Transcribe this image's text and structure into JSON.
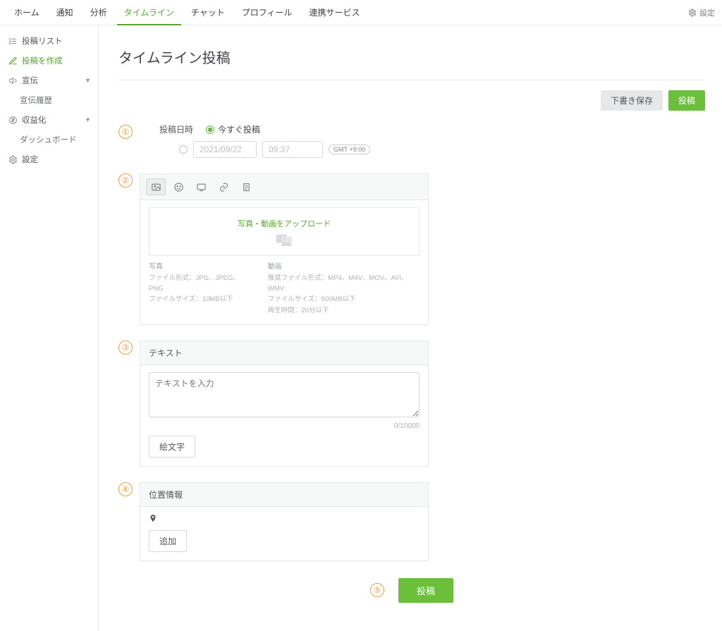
{
  "topnav": {
    "tabs": [
      "ホーム",
      "通知",
      "分析",
      "タイムライン",
      "チャット",
      "プロフィール",
      "連携サービス"
    ],
    "active_index": 3,
    "settings_label": "設定"
  },
  "sidebar": {
    "items": [
      {
        "label": "投稿リスト",
        "icon": "list",
        "kind": "item"
      },
      {
        "label": "投稿を作成",
        "icon": "compose",
        "kind": "item",
        "active": true
      },
      {
        "label": "宣伝",
        "icon": "megaphone",
        "kind": "group"
      },
      {
        "label": "宣伝履歴",
        "kind": "child"
      },
      {
        "label": "収益化",
        "icon": "coin",
        "kind": "group"
      },
      {
        "label": "ダッシュボード",
        "kind": "child"
      },
      {
        "label": "設定",
        "icon": "gear",
        "kind": "item"
      }
    ]
  },
  "page": {
    "title": "タイムライン投稿",
    "actions": {
      "save_draft": "下書き保存",
      "post": "投稿"
    }
  },
  "schedule": {
    "label": "投稿日時",
    "now_label": "今すぐ投稿",
    "date_value": "2021/09/22",
    "time_value": "09:37",
    "gmt_label": "GMT +9:00"
  },
  "media": {
    "upload_title": "写真・動画をアップロード",
    "photo": {
      "heading": "写真",
      "format": "ファイル形式：JPG、JPEG、PNG",
      "size": "ファイルサイズ：10MB以下"
    },
    "video": {
      "heading": "動画",
      "format": "推奨ファイル形式：MP4、M4V、MOV、AVI、WMV",
      "size": "ファイルサイズ：500MB以下",
      "duration": "再生時間：20分以下"
    }
  },
  "text": {
    "section_label": "テキスト",
    "placeholder": "テキストを入力",
    "counter": "0/10000",
    "emoji_button": "絵文字"
  },
  "location": {
    "section_label": "位置情報",
    "add_button": "追加"
  },
  "submit": {
    "post": "投稿"
  }
}
